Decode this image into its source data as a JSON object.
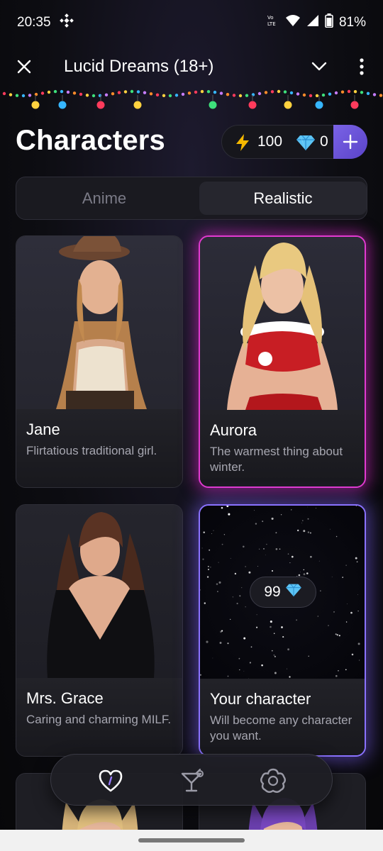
{
  "status_bar": {
    "time": "20:35",
    "battery": "81%",
    "icons": [
      "binance-icon",
      "volte-icon",
      "wifi-icon",
      "signal-icon",
      "battery-icon"
    ]
  },
  "app_bar": {
    "title": "Lucid Dreams (18+)",
    "icons": [
      "close-icon",
      "chevron-down-icon",
      "more-vert-icon"
    ]
  },
  "header": {
    "title": "Characters",
    "energy": "100",
    "gems": "0",
    "icons": [
      "lightning-icon",
      "diamond-icon",
      "plus-icon"
    ]
  },
  "tabs": [
    {
      "label": "Anime",
      "selected": false
    },
    {
      "label": "Realistic",
      "selected": true
    }
  ],
  "characters": [
    {
      "name": "Jane",
      "desc": "Flirtatious traditional girl.",
      "highlight": "none"
    },
    {
      "name": "Aurora",
      "desc": "The warmest thing about winter.",
      "highlight": "#e23ad0"
    },
    {
      "name": "Mrs. Grace",
      "desc": "Caring and charming MILF.",
      "highlight": "none"
    },
    {
      "name": "Your character",
      "desc": "Will become any character you want.",
      "price": "99",
      "highlight": "#8a72ff"
    }
  ],
  "bottom_nav": {
    "items": [
      "heart-icon",
      "cocktail-icon",
      "settings-flower-icon"
    ]
  },
  "colors": {
    "accent": "#7a63e6",
    "aurora_glow": "#e23ad0",
    "custom_glow": "#8a72ff"
  }
}
